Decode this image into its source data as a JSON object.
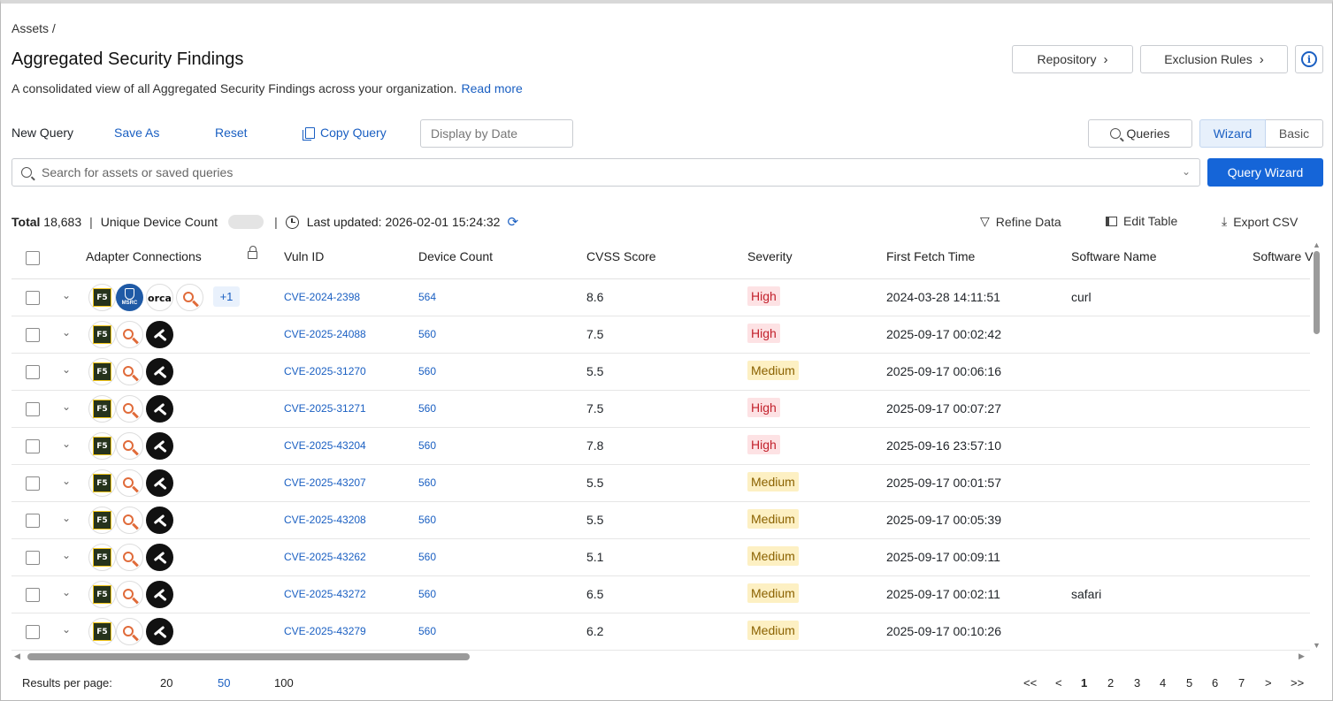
{
  "breadcrumb": "Assets /",
  "title": "Aggregated Security Findings",
  "description": "A consolidated view of all Aggregated Security Findings across your organization.",
  "read_more": "Read more",
  "header_buttons": {
    "repository": "Repository",
    "exclusion_rules": "Exclusion Rules"
  },
  "query_toolbar": {
    "new_query": "New Query",
    "save_as": "Save As",
    "reset": "Reset",
    "copy_query": "Copy Query",
    "display_by_date_placeholder": "Display by Date",
    "queries": "Queries",
    "wizard": "Wizard",
    "basic": "Basic"
  },
  "search": {
    "placeholder": "Search for assets or saved queries",
    "query_wizard": "Query Wizard"
  },
  "stats": {
    "total_label": "Total",
    "total_value": "18,683",
    "unique_device_count": "Unique Device Count",
    "last_updated_label": "Last updated:",
    "last_updated_value": "2026-02-01 15:24:32"
  },
  "table_tools": {
    "refine": "Refine Data",
    "edit": "Edit Table",
    "export": "Export CSV"
  },
  "columns": {
    "adapters": "Adapter Connections",
    "vuln_id": "Vuln ID",
    "device_count": "Device Count",
    "cvss": "CVSS Score",
    "severity": "Severity",
    "first_fetch": "First Fetch Time",
    "software_name": "Software Name",
    "software_version": "Software V"
  },
  "colors": {
    "accent": "#1565d8",
    "high_bg": "#fde2e4",
    "high_fg": "#c2202b",
    "medium_bg": "#fdf0c3",
    "medium_fg": "#8a6100"
  },
  "rows": [
    {
      "vuln": "CVE-2024-2398",
      "count": "564",
      "cvss": "8.6",
      "severity": "High",
      "sev": "high",
      "fetch": "2024-03-28 14:11:51",
      "software": "curl",
      "adapters": [
        "f5-icon",
        "msrc-icon",
        "orca-icon",
        "magnifier-icon"
      ],
      "plus": "+1"
    },
    {
      "vuln": "CVE-2025-24088",
      "count": "560",
      "cvss": "7.5",
      "severity": "High",
      "sev": "high",
      "fetch": "2025-09-17 00:02:42",
      "software": "",
      "adapters": [
        "f5-icon",
        "magnifier-icon",
        "dark-icon"
      ],
      "plus": ""
    },
    {
      "vuln": "CVE-2025-31270",
      "count": "560",
      "cvss": "5.5",
      "severity": "Medium",
      "sev": "med",
      "fetch": "2025-09-17 00:06:16",
      "software": "",
      "adapters": [
        "f5-icon",
        "magnifier-icon",
        "dark-icon"
      ],
      "plus": ""
    },
    {
      "vuln": "CVE-2025-31271",
      "count": "560",
      "cvss": "7.5",
      "severity": "High",
      "sev": "high",
      "fetch": "2025-09-17 00:07:27",
      "software": "",
      "adapters": [
        "f5-icon",
        "magnifier-icon",
        "dark-icon"
      ],
      "plus": ""
    },
    {
      "vuln": "CVE-2025-43204",
      "count": "560",
      "cvss": "7.8",
      "severity": "High",
      "sev": "high",
      "fetch": "2025-09-16 23:57:10",
      "software": "",
      "adapters": [
        "f5-icon",
        "magnifier-icon",
        "dark-icon"
      ],
      "plus": ""
    },
    {
      "vuln": "CVE-2025-43207",
      "count": "560",
      "cvss": "5.5",
      "severity": "Medium",
      "sev": "med",
      "fetch": "2025-09-17 00:01:57",
      "software": "",
      "adapters": [
        "f5-icon",
        "magnifier-icon",
        "dark-icon"
      ],
      "plus": ""
    },
    {
      "vuln": "CVE-2025-43208",
      "count": "560",
      "cvss": "5.5",
      "severity": "Medium",
      "sev": "med",
      "fetch": "2025-09-17 00:05:39",
      "software": "",
      "adapters": [
        "f5-icon",
        "magnifier-icon",
        "dark-icon"
      ],
      "plus": ""
    },
    {
      "vuln": "CVE-2025-43262",
      "count": "560",
      "cvss": "5.1",
      "severity": "Medium",
      "sev": "med",
      "fetch": "2025-09-17 00:09:11",
      "software": "",
      "adapters": [
        "f5-icon",
        "magnifier-icon",
        "dark-icon"
      ],
      "plus": ""
    },
    {
      "vuln": "CVE-2025-43272",
      "count": "560",
      "cvss": "6.5",
      "severity": "Medium",
      "sev": "med",
      "fetch": "2025-09-17 00:02:11",
      "software": "safari",
      "adapters": [
        "f5-icon",
        "magnifier-icon",
        "dark-icon"
      ],
      "plus": ""
    },
    {
      "vuln": "CVE-2025-43279",
      "count": "560",
      "cvss": "6.2",
      "severity": "Medium",
      "sev": "med",
      "fetch": "2025-09-17 00:10:26",
      "software": "",
      "adapters": [
        "f5-icon",
        "magnifier-icon",
        "dark-icon"
      ],
      "plus": ""
    }
  ],
  "footer": {
    "results_per_page": "Results per page:",
    "per_page_options": [
      "20",
      "50",
      "100"
    ],
    "per_page_selected": "50",
    "pages": [
      "<<",
      "<",
      "1",
      "2",
      "3",
      "4",
      "5",
      "6",
      "7",
      ">",
      ">>"
    ],
    "current_page": "1"
  }
}
